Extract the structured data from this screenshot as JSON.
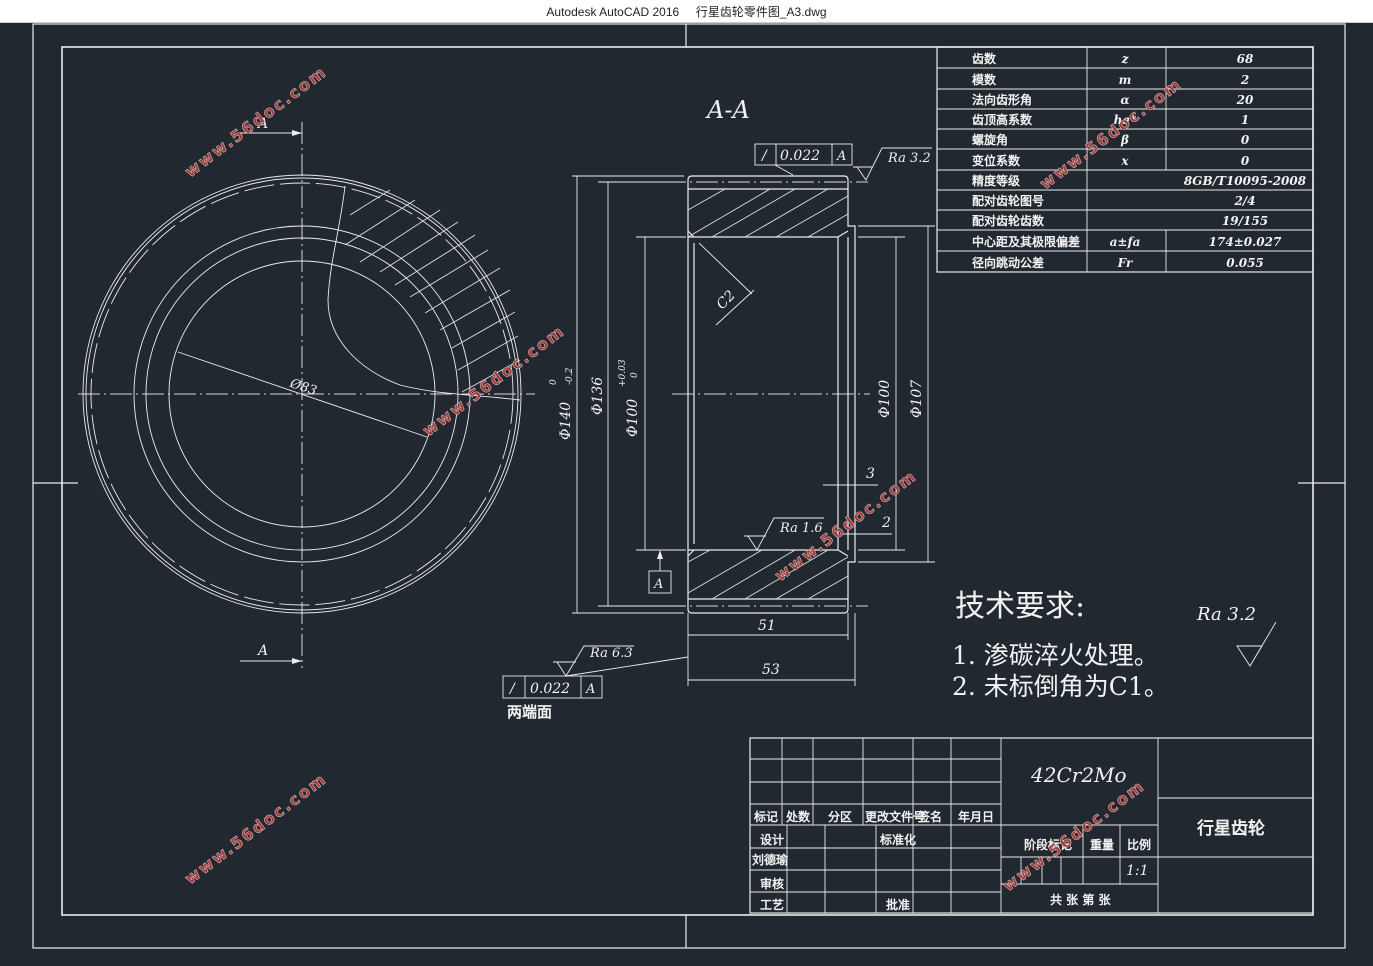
{
  "window": {
    "title": "Autodesk AutoCAD 2016     行星齿轮零件图_A3.dwg"
  },
  "colors": {
    "background": "#212830",
    "lines": "#ececec",
    "watermark": "#a03c3c"
  },
  "watermark": "www.56doc.com",
  "section_view": {
    "title": "A-A",
    "cut_label": "A",
    "dims": {
      "d140": "Φ140",
      "d140_tol_up": "0",
      "d140_tol_low": "-0.2",
      "d136": "Φ136",
      "d100_bore": "Φ100",
      "d100_tol_up": "+0.03",
      "d100_tol_low": "0",
      "d100": "Φ100",
      "d107": "Φ107",
      "chamfer": "C2",
      "w51": "51",
      "w53": "53",
      "d3": "3",
      "d2": "2"
    },
    "roughness_top": "Ra 3.2",
    "roughness_bore": "Ra 1.6",
    "roughness_face": "Ra 6.3",
    "tol_top": {
      "symbol": "/",
      "value": "0.022",
      "datum": "A"
    },
    "tol_face": {
      "symbol": "/",
      "value": "0.022",
      "datum": "A",
      "note": "两端面"
    },
    "datum": "A"
  },
  "front_view": {
    "bore_dim": "Ø83",
    "cut_label_top": "A",
    "cut_label_bottom": "A"
  },
  "params": [
    {
      "name": "齿数",
      "symbol": "z",
      "value": "68"
    },
    {
      "name": "模数",
      "symbol": "m",
      "value": "2"
    },
    {
      "name": "法向齿形角",
      "symbol": "α",
      "value": "20"
    },
    {
      "name": "齿顶高系数",
      "symbol": "ha*",
      "value": "1"
    },
    {
      "name": "螺旋角",
      "symbol": "β",
      "value": "0"
    },
    {
      "name": "变位系数",
      "symbol": "x",
      "value": "0"
    },
    {
      "name": "精度等级",
      "symbol": "",
      "value": "8GB/T10095-2008"
    },
    {
      "name": "配对齿轮图号",
      "symbol": "",
      "value": "2/4"
    },
    {
      "name": "配对齿轮齿数",
      "symbol": "",
      "value": "19/155"
    },
    {
      "name": "中心距及其极限偏差",
      "symbol": "a±fa",
      "value": "174±0.027"
    },
    {
      "name": "径向跳动公差",
      "symbol": "Fr",
      "value": "0.055"
    }
  ],
  "tech_req": {
    "title": "技术要求:",
    "items": [
      "1. 渗碳淬火处理。",
      "2. 未标倒角为C1。"
    ],
    "general_roughness": "Ra 3.2"
  },
  "title_block": {
    "material": "42Cr2Mo",
    "part_name": "行星齿轮",
    "headers": [
      "标记",
      "处数",
      "分区",
      "更改文件号",
      "签名",
      "年月日"
    ],
    "design": "设计",
    "designer": "刘德瑜",
    "standardize": "标准化",
    "check": "审核",
    "process": "工艺",
    "approve": "批准",
    "stage": "阶段标记",
    "weight": "重量",
    "scale_label": "比例",
    "scale": "1:1",
    "sheets": "共 张 第 张"
  }
}
